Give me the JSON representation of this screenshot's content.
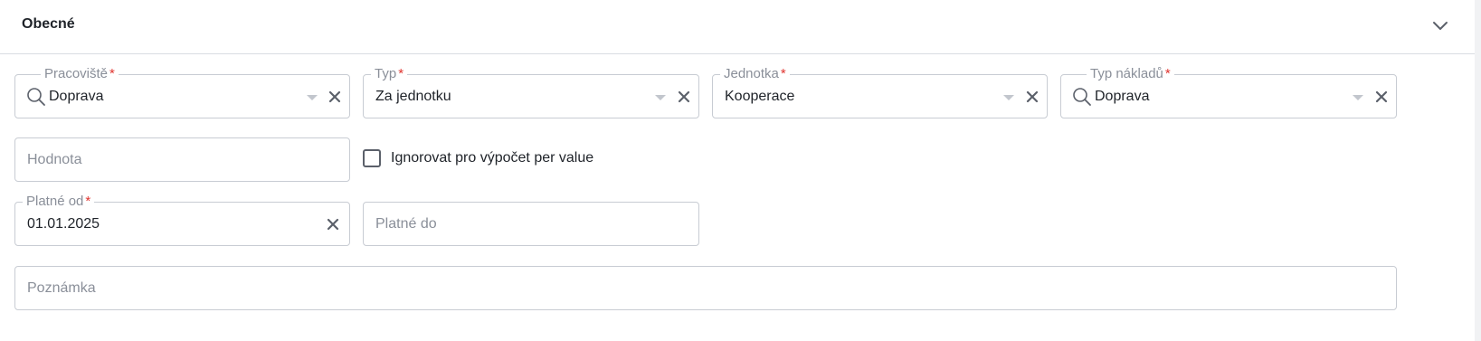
{
  "section": {
    "title": "Obecné"
  },
  "fields": {
    "pracoviste": {
      "label": "Pracoviště",
      "required_mark": "*",
      "value": "Doprava"
    },
    "typ": {
      "label": "Typ",
      "required_mark": "*",
      "value": "Za jednotku"
    },
    "jednotka": {
      "label": "Jednotka",
      "required_mark": "*",
      "value": "Kooperace"
    },
    "typ_nakladu": {
      "label": "Typ nákladů",
      "required_mark": "*",
      "value": "Doprava"
    },
    "hodnota": {
      "placeholder": "Hodnota"
    },
    "ignorovat": {
      "label": "Ignorovat pro výpočet per value",
      "checked": false
    },
    "platne_od": {
      "label": "Platné od",
      "required_mark": "*",
      "value": "01.01.2025"
    },
    "platne_do": {
      "placeholder": "Platné do"
    },
    "poznamka": {
      "placeholder": "Poznámka"
    }
  },
  "icons": {
    "search": "search-icon",
    "dropdown": "caret-down-icon",
    "clear": "close-icon",
    "collapse": "chevron-down-icon"
  },
  "colors": {
    "required": "#e0342f",
    "border": "#c8ccd3",
    "label": "#8a8f99",
    "text": "#1f2329"
  }
}
